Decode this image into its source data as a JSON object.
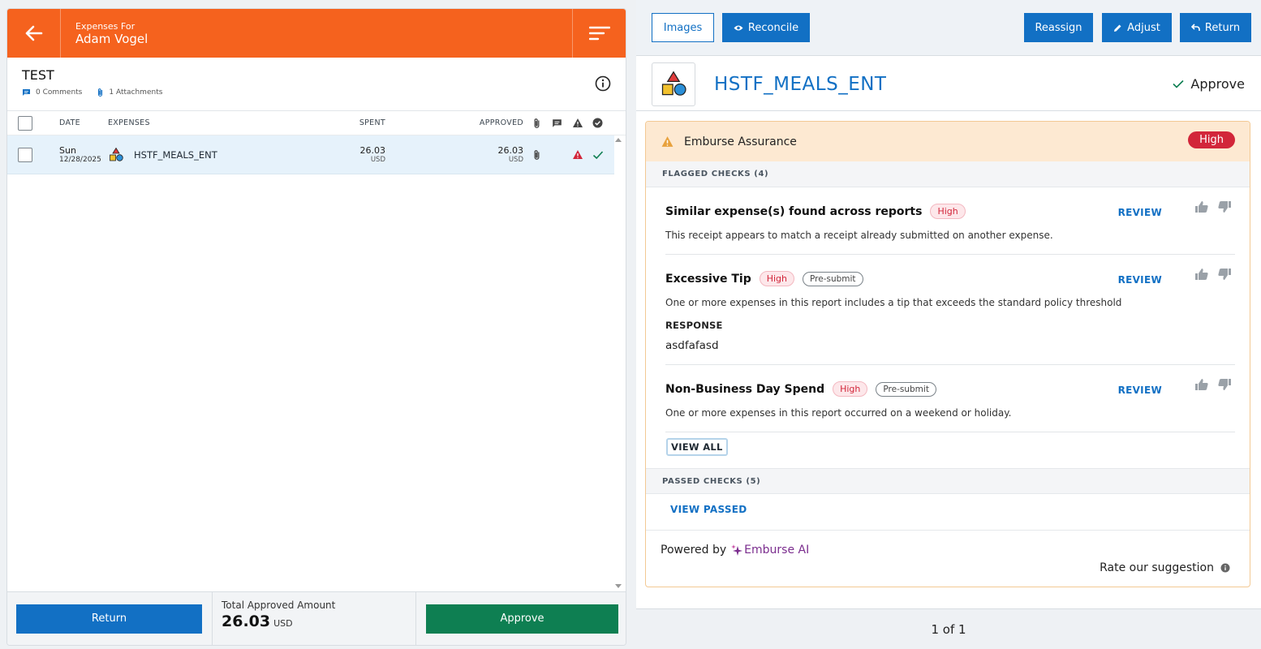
{
  "left_header": {
    "small": "Expenses For",
    "name": "Adam Vogel"
  },
  "report": {
    "title": "TEST",
    "comments": "0 Comments",
    "attachments": "1 Attachments"
  },
  "table": {
    "headers": {
      "date": "DATE",
      "expenses": "EXPENSES",
      "spent": "SPENT",
      "approved": "APPROVED"
    },
    "rows": [
      {
        "day": "Sun",
        "date": "12/28/2025",
        "expense": "HSTF_MEALS_ENT",
        "spent": "26.03",
        "spent_cur": "USD",
        "approved": "26.03",
        "approved_cur": "USD"
      }
    ]
  },
  "footer_left": {
    "return": "Return",
    "total_label": "Total Approved Amount",
    "total_value": "26.03",
    "total_cur": "USD",
    "approve": "Approve"
  },
  "toolbar": {
    "images": "Images",
    "reconcile": "Reconcile",
    "reassign": "Reassign",
    "adjust": "Adjust",
    "return": "Return"
  },
  "expense": {
    "title": "HSTF_MEALS_ENT",
    "approve": "Approve"
  },
  "assurance": {
    "title": "Emburse Assurance",
    "risk": "High",
    "flagged_label": "FLAGGED CHECKS (4)",
    "checks": [
      {
        "title": "Similar expense(s) found across reports",
        "level": "High",
        "tag": "",
        "desc": "This receipt appears to match a receipt already submitted on another expense.",
        "review": "REVIEW"
      },
      {
        "title": "Excessive Tip",
        "level": "High",
        "tag": "Pre-submit",
        "desc": "One or more expenses in this report includes a tip that exceeds the standard policy threshold",
        "response_label": "RESPONSE",
        "response": "asdfafasd",
        "review": "REVIEW"
      },
      {
        "title": "Non-Business Day Spend",
        "level": "High",
        "tag": "Pre-submit",
        "desc": "One or more expenses in this report occurred on a weekend or holiday.",
        "review": "REVIEW"
      }
    ],
    "view_all": "VIEW ALL",
    "passed_label": "PASSED CHECKS (5)",
    "view_passed": "VIEW PASSED",
    "powered_by": "Powered by",
    "emburse_ai": "Emburse AI",
    "rate": "Rate our suggestion"
  },
  "pagination": "1 of 1",
  "colors": {
    "header_orange": "#f5621e",
    "primary_blue": "#1270c4",
    "approve_green": "#0e7f52",
    "risk_red": "#d2263a"
  }
}
